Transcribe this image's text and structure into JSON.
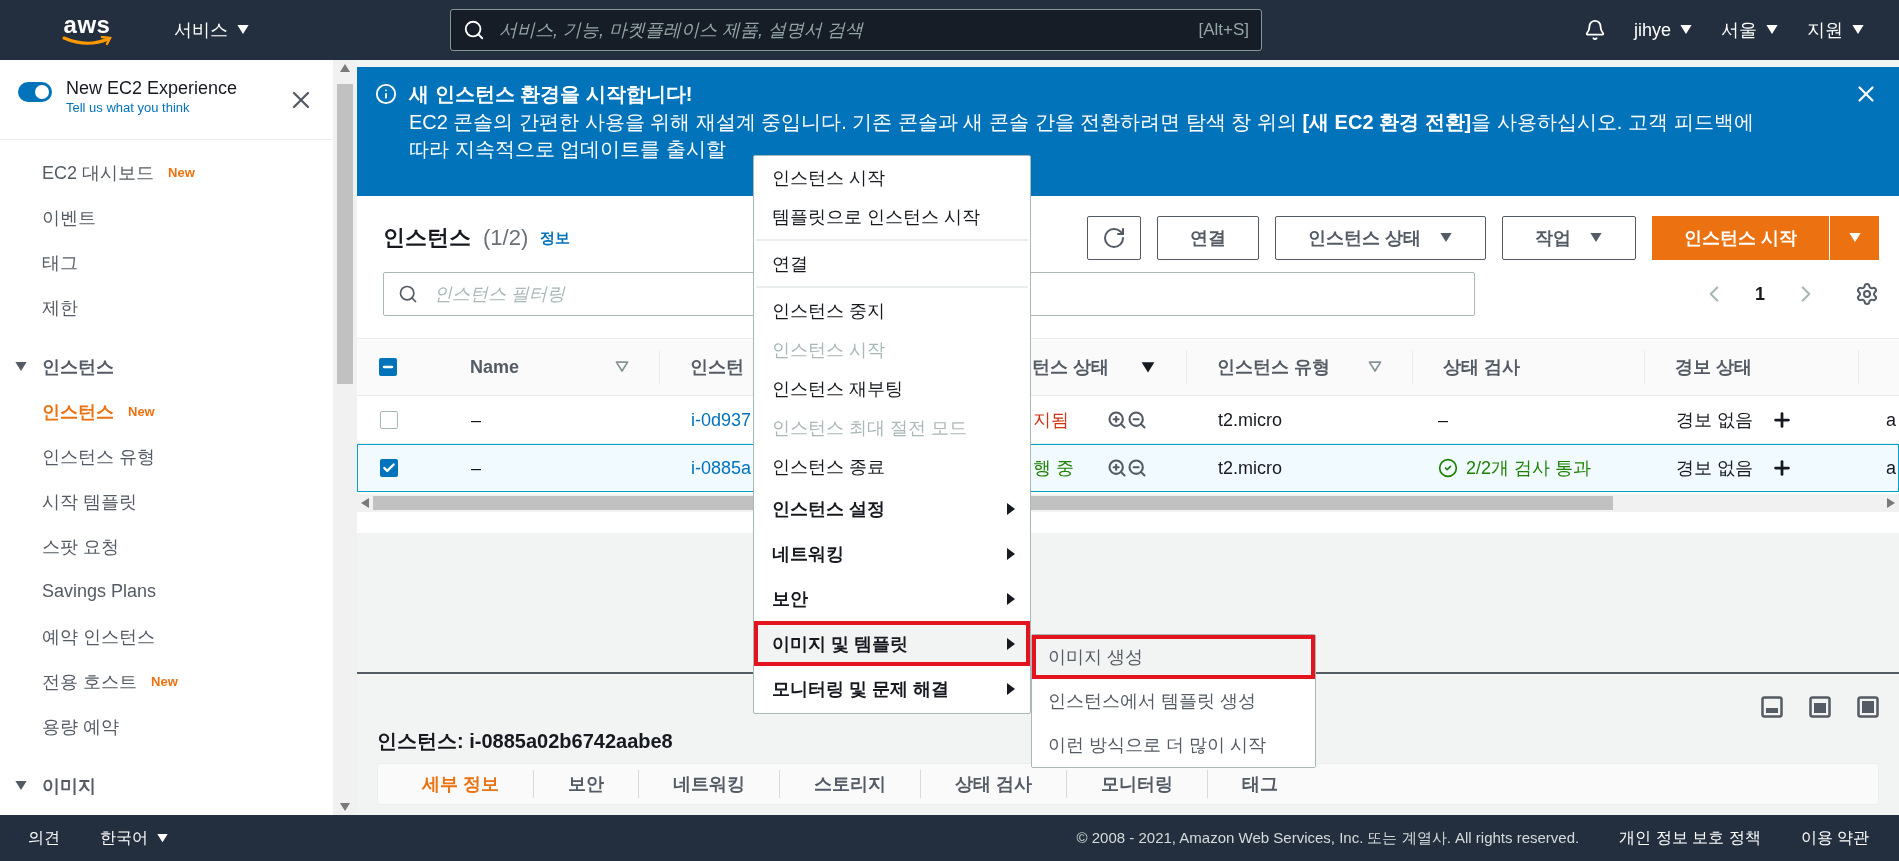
{
  "top_nav": {
    "logo": "aws",
    "services": "서비스",
    "search": {
      "placeholder": "서비스, 기능, 마켓플레이스 제품, 설명서 검색",
      "shortcut": "[Alt+S]"
    },
    "user": "jihye",
    "region": "서울",
    "support": "지원"
  },
  "sidebar": {
    "experience": {
      "on": true,
      "label": "New EC2 Experience",
      "link": "Tell us what you think"
    },
    "items": [
      {
        "label": "EC2 대시보드",
        "badge": "New",
        "selected": false
      },
      {
        "label": "이벤트",
        "selected": false
      },
      {
        "label": "태그",
        "selected": false
      },
      {
        "label": "제한",
        "selected": false
      }
    ],
    "sections": [
      {
        "label": "인스턴스",
        "expanded": true,
        "children": [
          {
            "label": "인스턴스",
            "badge": "New",
            "selected": true
          },
          {
            "label": "인스턴스 유형",
            "selected": false
          },
          {
            "label": "시작 템플릿",
            "selected": false
          },
          {
            "label": "스팟 요청",
            "selected": false
          },
          {
            "label": "Savings Plans",
            "selected": false
          },
          {
            "label": "예약 인스턴스",
            "selected": false
          },
          {
            "label": "전용 호스트",
            "badge": "New",
            "selected": false
          },
          {
            "label": "용량 예약",
            "selected": false
          }
        ]
      },
      {
        "label": "이미지",
        "expanded": true
      }
    ]
  },
  "banner": {
    "title": "새 인스턴스 환경을 시작합니다!",
    "lines": [
      "EC2 콘솔의 간편한 사용을 위해 재설계 중입니다. 기존 콘솔과 새 콘솔 간을 전환하려면 탐색 창 위의 **[새 EC2 환경 전환]**을 사용하십시오. 고객 피드백에",
      "따라 지속적으로 업데이트를 출시할"
    ]
  },
  "instances": {
    "title": "인스턴스",
    "count": "(1/2)",
    "info": "정보",
    "buttons": [
      {
        "label": "연결",
        "kind": "plain"
      },
      {
        "label": "인스턴스 상태",
        "kind": "dropdown"
      },
      {
        "label": "작업",
        "kind": "dropdown"
      },
      {
        "label": "인스턴스 시작",
        "kind": "primary"
      }
    ],
    "filter": {
      "placeholder": "인스턴스 필터링"
    },
    "page": "1",
    "partially_selected": true,
    "columns": [
      {
        "label": "Name",
        "sorted": false
      },
      {
        "label": "인스턴"
      },
      {
        "label": "턴스 상태",
        "sorted": true
      },
      {
        "label": "인스턴스 유형",
        "sorted": false
      },
      {
        "label": "상태 검사"
      },
      {
        "label": "경보 상태"
      }
    ],
    "rows": [
      {
        "selected": false,
        "name": "–",
        "id": "i-0d937",
        "state": {
          "text": "지됨",
          "color": "#d13212"
        },
        "type": "t2.micro",
        "status_check": {
          "text": "–",
          "passed": false
        },
        "alarm": "경보 없음",
        "column_8": "a"
      },
      {
        "selected": true,
        "name": "–",
        "id": "i-0885a",
        "state": {
          "text": "행 중",
          "color": "#1d8102"
        },
        "type": "t2.micro",
        "status_check": {
          "text": "2/2개 검사 통과",
          "passed": true
        },
        "alarm": "경보 없음",
        "column_8": "a"
      }
    ]
  },
  "context_menu": {
    "items": [
      {
        "label": "인스턴스 시작",
        "kind": "action",
        "disabled": false,
        "highlighted": false
      },
      {
        "label": "템플릿으로 인스턴스 시작",
        "kind": "action",
        "disabled": false,
        "highlighted": false
      },
      {
        "kind": "separator"
      },
      {
        "label": "연결",
        "kind": "action",
        "disabled": false,
        "highlighted": false
      },
      {
        "kind": "separator"
      },
      {
        "label": "인스턴스 중지",
        "kind": "action",
        "disabled": false,
        "highlighted": false
      },
      {
        "label": "인스턴스 시작",
        "kind": "action",
        "disabled": true,
        "highlighted": false
      },
      {
        "label": "인스턴스 재부팅",
        "kind": "action",
        "disabled": false,
        "highlighted": false
      },
      {
        "label": "인스턴스 최대 절전 모드",
        "kind": "action",
        "disabled": true,
        "highlighted": false
      },
      {
        "label": "인스턴스 종료",
        "kind": "action",
        "disabled": false,
        "highlighted": false
      },
      {
        "label": "인스턴스 설정",
        "kind": "submenu",
        "disabled": false,
        "highlighted": false
      },
      {
        "label": "네트워킹",
        "kind": "submenu",
        "disabled": false,
        "highlighted": false
      },
      {
        "label": "보안",
        "kind": "submenu",
        "disabled": false,
        "highlighted": false
      },
      {
        "label": "이미지 및 템플릿",
        "kind": "submenu",
        "disabled": false,
        "highlighted": true
      },
      {
        "label": "모니터링 및 문제 해결",
        "kind": "submenu",
        "disabled": false,
        "highlighted": false
      }
    ]
  },
  "submenu": {
    "items": [
      {
        "label": "이미지 생성",
        "highlighted": true
      },
      {
        "label": "인스턴스에서 템플릿 생성",
        "highlighted": false
      },
      {
        "label": "이런 방식으로 더 많이 시작",
        "highlighted": false
      }
    ]
  },
  "details": {
    "title": "인스턴스: i-0885a02b6742aabe8",
    "tabs": [
      {
        "label": "세부 정보",
        "selected": true
      },
      {
        "label": "보안",
        "selected": false
      },
      {
        "label": "네트워킹",
        "selected": false
      },
      {
        "label": "스토리지",
        "selected": false
      },
      {
        "label": "상태 검사",
        "selected": false
      },
      {
        "label": "모니터링",
        "selected": false
      },
      {
        "label": "태그",
        "selected": false
      }
    ]
  },
  "footer": {
    "feedback": "의견",
    "language": "한국어",
    "copyright": "© 2008 - 2021, Amazon Web Services, Inc. 또는 계열사. All rights reserved.",
    "links": [
      "개인 정보 보호 정책",
      "이용 약관"
    ]
  }
}
